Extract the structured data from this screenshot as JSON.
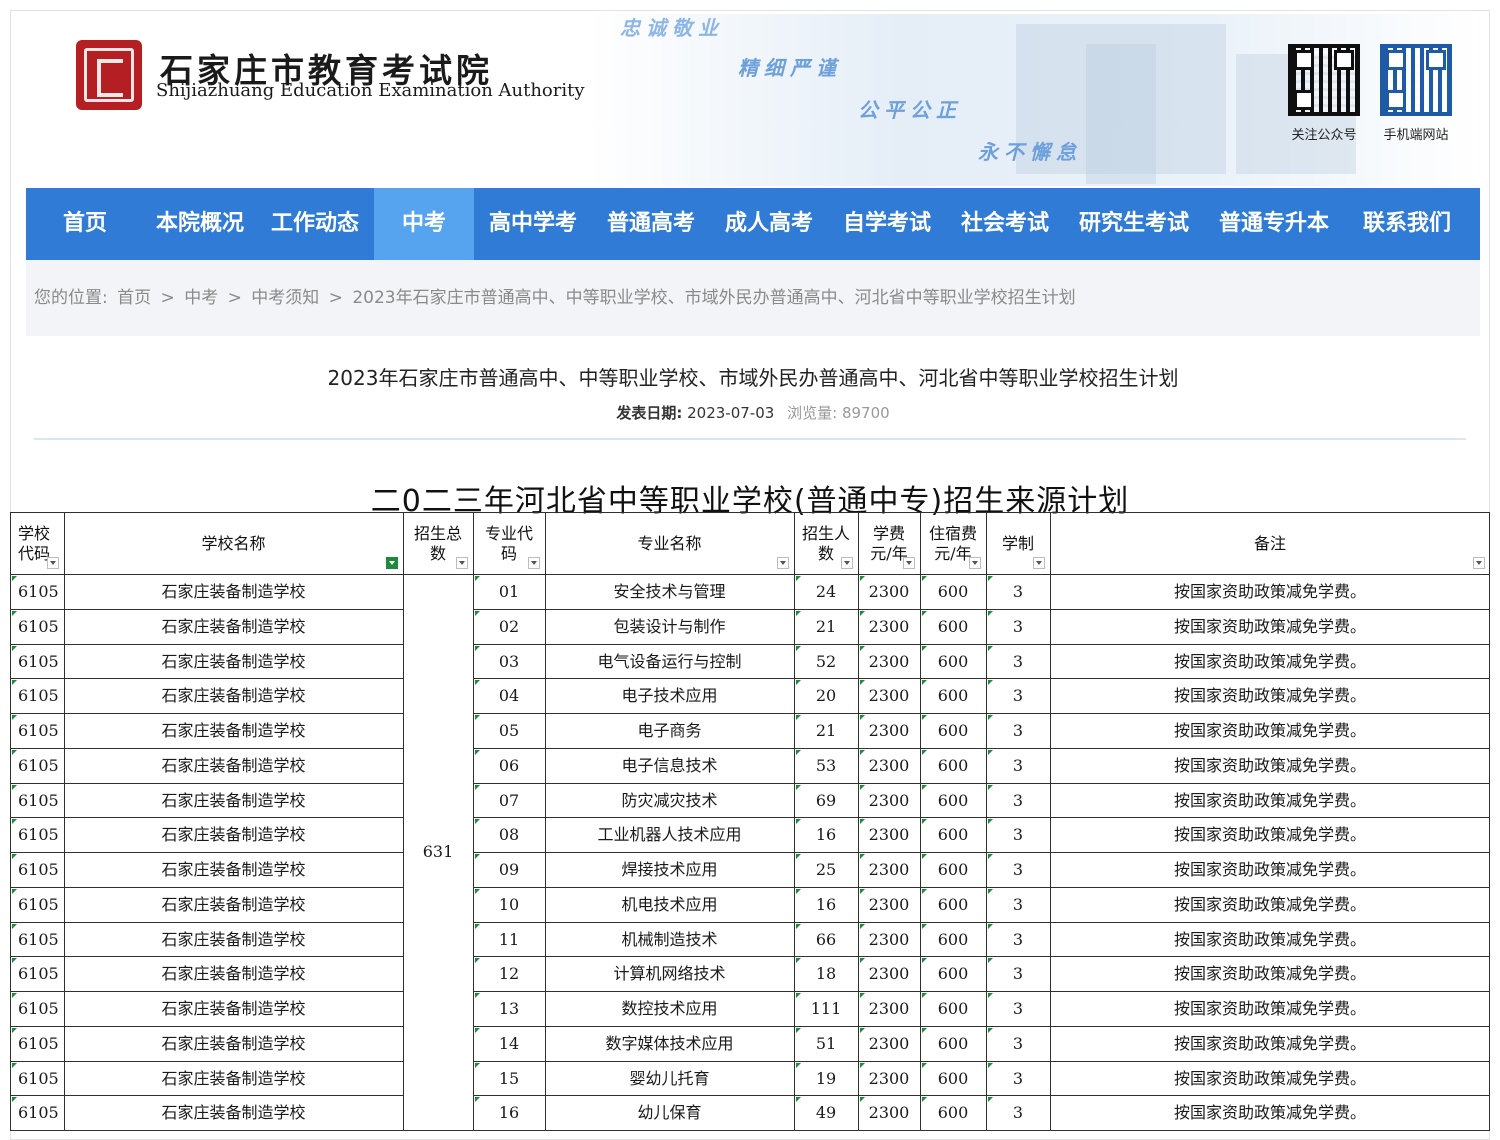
{
  "header": {
    "site_name_cn": "石家庄市教育考试院",
    "site_name_en": "Shijiazhuang Education Examination Authority",
    "slogans": [
      "忠诚敬业",
      "精细严谨",
      "公平公正",
      "永不懈怠"
    ],
    "qr_wechat_label": "关注公众号",
    "qr_mobile_label": "手机端网站"
  },
  "nav": {
    "items": [
      "首页",
      "本院概况",
      "工作动态",
      "中考",
      "高中学考",
      "普通高考",
      "成人高考",
      "自学考试",
      "社会考试",
      "研究生考试",
      "普通专升本",
      "联系我们"
    ],
    "active_index": 3,
    "active_color": "#56a3ef",
    "bar_color": "#2f7bd6"
  },
  "breadcrumb": {
    "prefix": "您的位置:",
    "items": [
      "首页",
      "中考",
      "中考须知",
      "2023年石家庄市普通高中、中等职业学校、市域外民办普通高中、河北省中等职业学校招生计划"
    ],
    "separator": ">"
  },
  "article": {
    "title": "2023年石家庄市普通高中、中等职业学校、市域外民办普通高中、河北省中等职业学校招生计划",
    "date_label": "发表日期:",
    "date": "2023-07-03",
    "views_label": "浏览量:",
    "views": "89700"
  },
  "table": {
    "title": "二0二三年河北省中等职业学校(普通中专)招生来源计划",
    "headers": [
      "学校代码",
      "学校名称",
      "招生总数",
      "专业代码",
      "专业名称",
      "招生人数",
      "学费元/年",
      "住宿费元/年",
      "学制",
      "备注"
    ],
    "header_lines": [
      [
        "学校",
        "代码"
      ],
      [
        "学校名称"
      ],
      [
        "招生总",
        "数"
      ],
      [
        "专业代",
        "码"
      ],
      [
        "专业名称"
      ],
      [
        "招生人",
        "数"
      ],
      [
        "学费",
        "元/年"
      ],
      [
        "住宿费",
        "元/年"
      ],
      [
        "学制"
      ],
      [
        "备注"
      ]
    ],
    "active_filter_column": "学校名称",
    "total_enrollment": "631",
    "rows": [
      {
        "school_code": "6105",
        "school": "石家庄装备制造学校",
        "major_code": "01",
        "major": "安全技术与管理",
        "count": "24",
        "tuition": "2300",
        "lodging": "600",
        "years": "3",
        "note": "按国家资助政策减免学费。"
      },
      {
        "school_code": "6105",
        "school": "石家庄装备制造学校",
        "major_code": "02",
        "major": "包装设计与制作",
        "count": "21",
        "tuition": "2300",
        "lodging": "600",
        "years": "3",
        "note": "按国家资助政策减免学费。"
      },
      {
        "school_code": "6105",
        "school": "石家庄装备制造学校",
        "major_code": "03",
        "major": "电气设备运行与控制",
        "count": "52",
        "tuition": "2300",
        "lodging": "600",
        "years": "3",
        "note": "按国家资助政策减免学费。"
      },
      {
        "school_code": "6105",
        "school": "石家庄装备制造学校",
        "major_code": "04",
        "major": "电子技术应用",
        "count": "20",
        "tuition": "2300",
        "lodging": "600",
        "years": "3",
        "note": "按国家资助政策减免学费。"
      },
      {
        "school_code": "6105",
        "school": "石家庄装备制造学校",
        "major_code": "05",
        "major": "电子商务",
        "count": "21",
        "tuition": "2300",
        "lodging": "600",
        "years": "3",
        "note": "按国家资助政策减免学费。"
      },
      {
        "school_code": "6105",
        "school": "石家庄装备制造学校",
        "major_code": "06",
        "major": "电子信息技术",
        "count": "53",
        "tuition": "2300",
        "lodging": "600",
        "years": "3",
        "note": "按国家资助政策减免学费。"
      },
      {
        "school_code": "6105",
        "school": "石家庄装备制造学校",
        "major_code": "07",
        "major": "防灾减灾技术",
        "count": "69",
        "tuition": "2300",
        "lodging": "600",
        "years": "3",
        "note": "按国家资助政策减免学费。"
      },
      {
        "school_code": "6105",
        "school": "石家庄装备制造学校",
        "major_code": "08",
        "major": "工业机器人技术应用",
        "count": "16",
        "tuition": "2300",
        "lodging": "600",
        "years": "3",
        "note": "按国家资助政策减免学费。"
      },
      {
        "school_code": "6105",
        "school": "石家庄装备制造学校",
        "major_code": "09",
        "major": "焊接技术应用",
        "count": "25",
        "tuition": "2300",
        "lodging": "600",
        "years": "3",
        "note": "按国家资助政策减免学费。"
      },
      {
        "school_code": "6105",
        "school": "石家庄装备制造学校",
        "major_code": "10",
        "major": "机电技术应用",
        "count": "16",
        "tuition": "2300",
        "lodging": "600",
        "years": "3",
        "note": "按国家资助政策减免学费。"
      },
      {
        "school_code": "6105",
        "school": "石家庄装备制造学校",
        "major_code": "11",
        "major": "机械制造技术",
        "count": "66",
        "tuition": "2300",
        "lodging": "600",
        "years": "3",
        "note": "按国家资助政策减免学费。"
      },
      {
        "school_code": "6105",
        "school": "石家庄装备制造学校",
        "major_code": "12",
        "major": "计算机网络技术",
        "count": "18",
        "tuition": "2300",
        "lodging": "600",
        "years": "3",
        "note": "按国家资助政策减免学费。"
      },
      {
        "school_code": "6105",
        "school": "石家庄装备制造学校",
        "major_code": "13",
        "major": "数控技术应用",
        "count": "111",
        "tuition": "2300",
        "lodging": "600",
        "years": "3",
        "note": "按国家资助政策减免学费。"
      },
      {
        "school_code": "6105",
        "school": "石家庄装备制造学校",
        "major_code": "14",
        "major": "数字媒体技术应用",
        "count": "51",
        "tuition": "2300",
        "lodging": "600",
        "years": "3",
        "note": "按国家资助政策减免学费。"
      },
      {
        "school_code": "6105",
        "school": "石家庄装备制造学校",
        "major_code": "15",
        "major": "婴幼儿托育",
        "count": "19",
        "tuition": "2300",
        "lodging": "600",
        "years": "3",
        "note": "按国家资助政策减免学费。"
      },
      {
        "school_code": "6105",
        "school": "石家庄装备制造学校",
        "major_code": "16",
        "major": "幼儿保育",
        "count": "49",
        "tuition": "2300",
        "lodging": "600",
        "years": "3",
        "note": "按国家资助政策减免学费。"
      }
    ]
  }
}
